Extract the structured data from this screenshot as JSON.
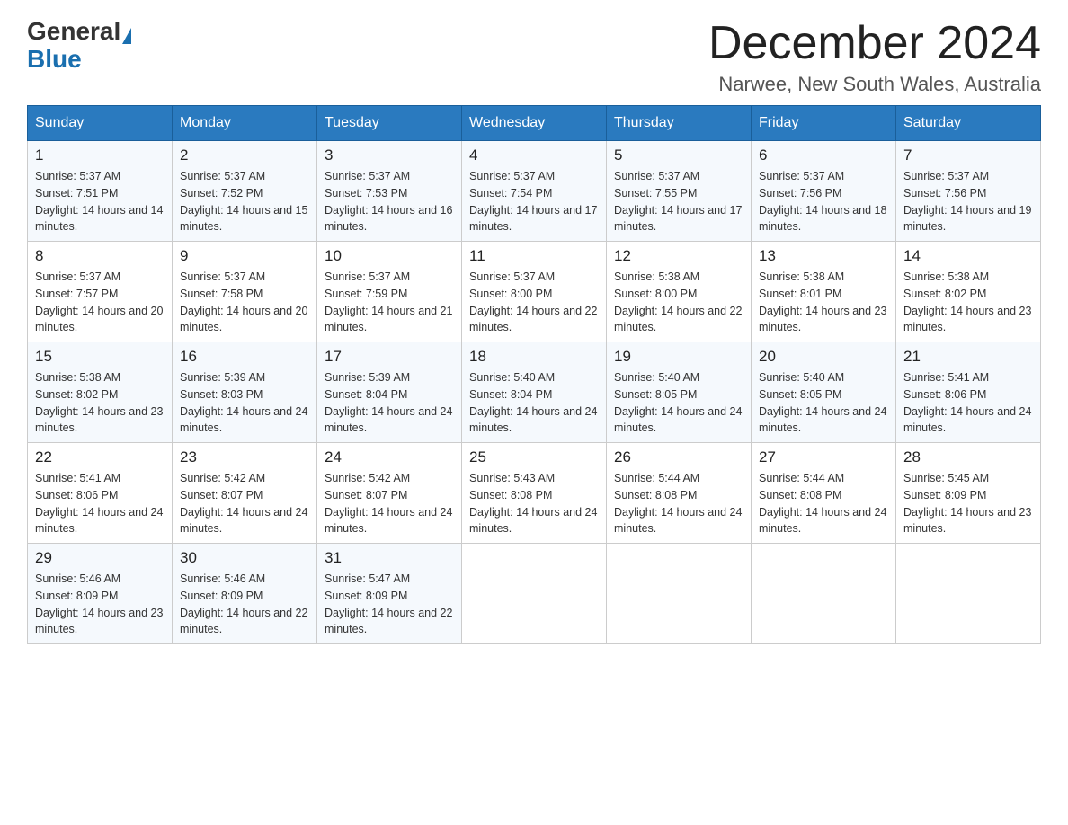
{
  "header": {
    "logo_general": "General",
    "logo_blue": "Blue",
    "month_title": "December 2024",
    "location": "Narwee, New South Wales, Australia"
  },
  "days_of_week": [
    "Sunday",
    "Monday",
    "Tuesday",
    "Wednesday",
    "Thursday",
    "Friday",
    "Saturday"
  ],
  "weeks": [
    [
      {
        "day": "1",
        "sunrise": "5:37 AM",
        "sunset": "7:51 PM",
        "daylight": "14 hours and 14 minutes."
      },
      {
        "day": "2",
        "sunrise": "5:37 AM",
        "sunset": "7:52 PM",
        "daylight": "14 hours and 15 minutes."
      },
      {
        "day": "3",
        "sunrise": "5:37 AM",
        "sunset": "7:53 PM",
        "daylight": "14 hours and 16 minutes."
      },
      {
        "day": "4",
        "sunrise": "5:37 AM",
        "sunset": "7:54 PM",
        "daylight": "14 hours and 17 minutes."
      },
      {
        "day": "5",
        "sunrise": "5:37 AM",
        "sunset": "7:55 PM",
        "daylight": "14 hours and 17 minutes."
      },
      {
        "day": "6",
        "sunrise": "5:37 AM",
        "sunset": "7:56 PM",
        "daylight": "14 hours and 18 minutes."
      },
      {
        "day": "7",
        "sunrise": "5:37 AM",
        "sunset": "7:56 PM",
        "daylight": "14 hours and 19 minutes."
      }
    ],
    [
      {
        "day": "8",
        "sunrise": "5:37 AM",
        "sunset": "7:57 PM",
        "daylight": "14 hours and 20 minutes."
      },
      {
        "day": "9",
        "sunrise": "5:37 AM",
        "sunset": "7:58 PM",
        "daylight": "14 hours and 20 minutes."
      },
      {
        "day": "10",
        "sunrise": "5:37 AM",
        "sunset": "7:59 PM",
        "daylight": "14 hours and 21 minutes."
      },
      {
        "day": "11",
        "sunrise": "5:37 AM",
        "sunset": "8:00 PM",
        "daylight": "14 hours and 22 minutes."
      },
      {
        "day": "12",
        "sunrise": "5:38 AM",
        "sunset": "8:00 PM",
        "daylight": "14 hours and 22 minutes."
      },
      {
        "day": "13",
        "sunrise": "5:38 AM",
        "sunset": "8:01 PM",
        "daylight": "14 hours and 23 minutes."
      },
      {
        "day": "14",
        "sunrise": "5:38 AM",
        "sunset": "8:02 PM",
        "daylight": "14 hours and 23 minutes."
      }
    ],
    [
      {
        "day": "15",
        "sunrise": "5:38 AM",
        "sunset": "8:02 PM",
        "daylight": "14 hours and 23 minutes."
      },
      {
        "day": "16",
        "sunrise": "5:39 AM",
        "sunset": "8:03 PM",
        "daylight": "14 hours and 24 minutes."
      },
      {
        "day": "17",
        "sunrise": "5:39 AM",
        "sunset": "8:04 PM",
        "daylight": "14 hours and 24 minutes."
      },
      {
        "day": "18",
        "sunrise": "5:40 AM",
        "sunset": "8:04 PM",
        "daylight": "14 hours and 24 minutes."
      },
      {
        "day": "19",
        "sunrise": "5:40 AM",
        "sunset": "8:05 PM",
        "daylight": "14 hours and 24 minutes."
      },
      {
        "day": "20",
        "sunrise": "5:40 AM",
        "sunset": "8:05 PM",
        "daylight": "14 hours and 24 minutes."
      },
      {
        "day": "21",
        "sunrise": "5:41 AM",
        "sunset": "8:06 PM",
        "daylight": "14 hours and 24 minutes."
      }
    ],
    [
      {
        "day": "22",
        "sunrise": "5:41 AM",
        "sunset": "8:06 PM",
        "daylight": "14 hours and 24 minutes."
      },
      {
        "day": "23",
        "sunrise": "5:42 AM",
        "sunset": "8:07 PM",
        "daylight": "14 hours and 24 minutes."
      },
      {
        "day": "24",
        "sunrise": "5:42 AM",
        "sunset": "8:07 PM",
        "daylight": "14 hours and 24 minutes."
      },
      {
        "day": "25",
        "sunrise": "5:43 AM",
        "sunset": "8:08 PM",
        "daylight": "14 hours and 24 minutes."
      },
      {
        "day": "26",
        "sunrise": "5:44 AM",
        "sunset": "8:08 PM",
        "daylight": "14 hours and 24 minutes."
      },
      {
        "day": "27",
        "sunrise": "5:44 AM",
        "sunset": "8:08 PM",
        "daylight": "14 hours and 24 minutes."
      },
      {
        "day": "28",
        "sunrise": "5:45 AM",
        "sunset": "8:09 PM",
        "daylight": "14 hours and 23 minutes."
      }
    ],
    [
      {
        "day": "29",
        "sunrise": "5:46 AM",
        "sunset": "8:09 PM",
        "daylight": "14 hours and 23 minutes."
      },
      {
        "day": "30",
        "sunrise": "5:46 AM",
        "sunset": "8:09 PM",
        "daylight": "14 hours and 22 minutes."
      },
      {
        "day": "31",
        "sunrise": "5:47 AM",
        "sunset": "8:09 PM",
        "daylight": "14 hours and 22 minutes."
      },
      null,
      null,
      null,
      null
    ]
  ],
  "labels": {
    "sunrise": "Sunrise:",
    "sunset": "Sunset:",
    "daylight": "Daylight:"
  }
}
